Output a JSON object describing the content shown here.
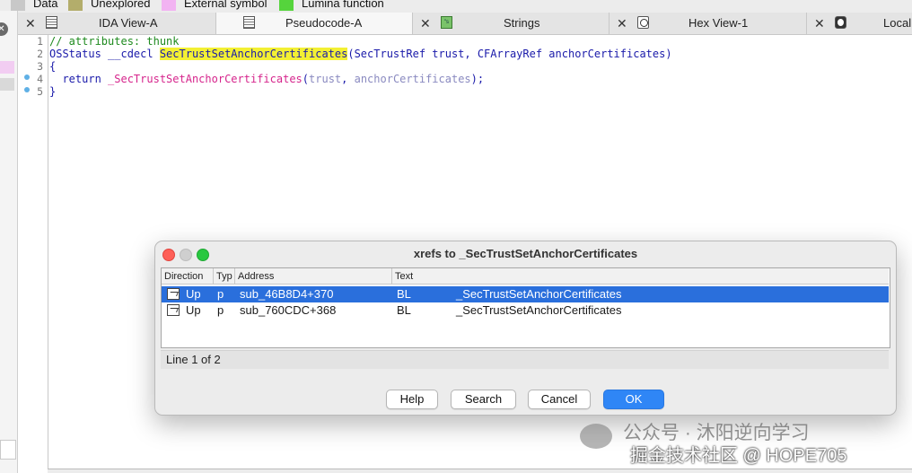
{
  "legend": {
    "items": [
      {
        "label": "Data",
        "color": "#c8c8c8"
      },
      {
        "label": "Unexplored",
        "color": "#b3ad6b"
      },
      {
        "label": "External symbol",
        "color": "#f2b3f2"
      },
      {
        "label": "Lumina function",
        "color": "#55d43c"
      }
    ]
  },
  "tabs": [
    {
      "label": "IDA View-A",
      "icon": "grid-view-icon",
      "active": false
    },
    {
      "label": "Pseudocode-A",
      "icon": "pseudocode-icon",
      "active": true
    },
    {
      "label": "Strings",
      "icon": "strings-icon",
      "active": false
    },
    {
      "label": "Hex View-1",
      "icon": "hex-view-icon",
      "active": false
    },
    {
      "label": "Local",
      "icon": "local-types-icon",
      "active": false
    }
  ],
  "code": {
    "line_numbers": [
      "1",
      "2",
      "3",
      "4",
      "5"
    ],
    "lines": [
      {
        "segments": [
          "// attributes: thunk"
        ]
      },
      {
        "segments": [
          "OSStatus __cdecl ",
          "SecTrustSetAnchorCertificates",
          "(SecTrustRef trust, CFArrayRef anchorCertificates)"
        ]
      },
      {
        "segments": [
          "{"
        ]
      },
      {
        "segments": [
          "  return ",
          "_SecTrustSetAnchorCertificates",
          "(",
          "trust",
          ", ",
          "anchorCertificates",
          ");"
        ]
      },
      {
        "segments": [
          "}"
        ]
      }
    ],
    "colors": {
      "comment": "#1e8a1e",
      "keyword": "#1a1aaa",
      "highlight": "#f3f033",
      "function": "#d6258c",
      "variable": "#8a8ac0"
    }
  },
  "dialog": {
    "title": "xrefs to _SecTrustSetAnchorCertificates",
    "columns": [
      "Direction",
      "Typ",
      "Address",
      "Text"
    ],
    "rows": [
      {
        "direction": "Up",
        "type": "p",
        "address": "sub_46B8D4+370",
        "insn": "BL",
        "target": "_SecTrustSetAnchorCertificates",
        "selected": true
      },
      {
        "direction": "Up",
        "type": "p",
        "address": "sub_760CDC+368",
        "insn": "BL",
        "target": "_SecTrustSetAnchorCertificates",
        "selected": false
      }
    ],
    "status": "Line 1 of 2",
    "buttons": {
      "help": "Help",
      "search": "Search",
      "cancel": "Cancel",
      "ok": "OK"
    },
    "selection_color": "#2a6fdc",
    "ok_color": "#2f86f6"
  },
  "watermark": {
    "line1": "公众号 · 沐阳逆向学习",
    "line2": "掘金技术社区 @ HOPE705"
  }
}
